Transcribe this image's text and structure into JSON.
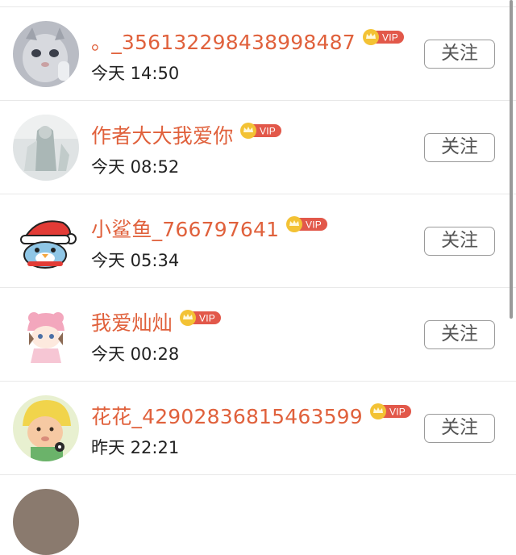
{
  "follow_label": "关注",
  "vip_text": "VIP",
  "colors": {
    "username": "#e0613c",
    "vip_badge": "#e2584a",
    "crown": "#f3c234"
  },
  "users": [
    {
      "name": "。_35613229843899848​7",
      "time": "今天 14:50",
      "avatar_icon": "cat-photo-icon"
    },
    {
      "name": "作者大大我爱你",
      "time": "今天 08:52",
      "avatar_icon": "anime-figure-icon"
    },
    {
      "name": "小鲨鱼_766797641",
      "time": "今天 05:34",
      "avatar_icon": "penguin-santa-hat-icon"
    },
    {
      "name": "我爱灿灿",
      "time": "今天 00:28",
      "avatar_icon": "cartoon-bear-girl-icon"
    },
    {
      "name": "花花_42902836815463599",
      "time": "昨天 22:21",
      "avatar_icon": "baby-photo-icon"
    }
  ]
}
